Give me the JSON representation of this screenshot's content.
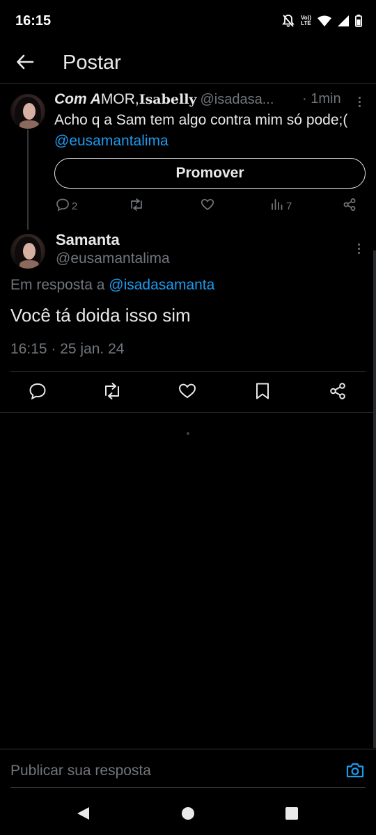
{
  "status_bar": {
    "time": "16:15",
    "lte_top": "Vo))",
    "lte_bottom": "LTE",
    "icons": [
      "bell-off-icon",
      "volte-lte-icon",
      "wifi-icon",
      "signal-icon",
      "battery-icon"
    ]
  },
  "header": {
    "title": "Postar",
    "back_icon": "arrow-left-icon"
  },
  "original_post": {
    "display_name_part1": "Com A",
    "display_name_part2": "MOR,",
    "display_name_part3": "Isabelly",
    "handle": "@isadasa...",
    "time": "· 1min",
    "text": "Acho q a Sam tem algo contra mim só pode;(",
    "mention": "@eusamantalima",
    "promote_label": "Promover",
    "reply_count": "2",
    "views_count": "7"
  },
  "main_post": {
    "display_name": "Samanta",
    "handle": "@eusamantalima",
    "reply_prefix": "Em resposta a",
    "reply_to_handle": "@isadasamanta",
    "text": "Você tá doida isso sim",
    "timestamp": "16:15 · 25 jan. 24"
  },
  "reply_composer": {
    "placeholder": "Publicar sua resposta"
  },
  "colors": {
    "accent": "#1d9bf0",
    "background": "#000000",
    "text_primary": "#e7e9ea",
    "text_secondary": "#71767b",
    "divider": "#2f3336"
  }
}
